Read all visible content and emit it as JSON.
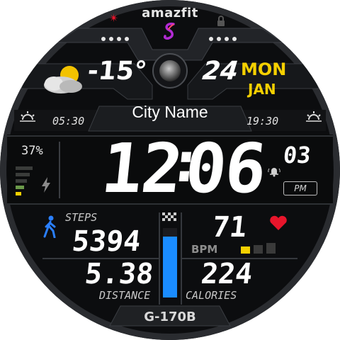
{
  "brand": "amazfit",
  "status": {
    "bt_icon": "bluetooth-icon",
    "lock_icon": "lock-icon"
  },
  "weather": {
    "icon": "partly-cloudy-sun-icon",
    "temperature": "-15°"
  },
  "date": {
    "day": "24",
    "weekday": "MON",
    "month": "JAN"
  },
  "city": "City Name",
  "sun": {
    "sunrise": "05:30",
    "sunset": "19:30"
  },
  "battery": {
    "percent": "37%",
    "level": 0.37
  },
  "time": {
    "hours": "12",
    "separator": ":",
    "minutes": "06",
    "seconds": "03",
    "ampm": "PM"
  },
  "steps": {
    "label": "STEPS",
    "value": "5394"
  },
  "distance": {
    "label": "DISTANCE",
    "value": "5.38"
  },
  "calories": {
    "label": "CALORIES",
    "value": "224"
  },
  "heart": {
    "value": "71",
    "label": "BPM"
  },
  "progress": {
    "level": 0.88
  },
  "model": "G-170B",
  "colors": {
    "accent_yellow": "#f5d000",
    "heart_red": "#e8152b",
    "bar_blue": "#1a8cff",
    "bt_red": "#e8152b"
  }
}
